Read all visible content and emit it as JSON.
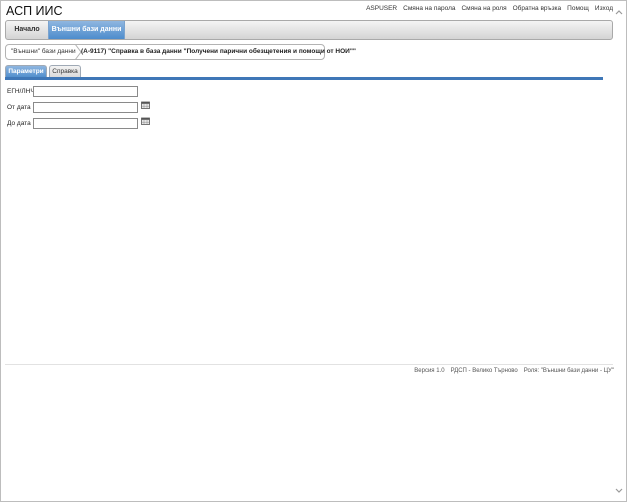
{
  "app": {
    "title": "АСП ИИС"
  },
  "toplinks": [
    "ASPUSER",
    "Смяна на парола",
    "Смяна на роля",
    "Обратна връзка",
    "Помощ",
    "Изход"
  ],
  "nav": {
    "home": "Начало",
    "active": "Външни бази данни"
  },
  "breadcrumb": {
    "first": "\"Външни\" бази данни",
    "current": "(А-9117) \"Справка в база данни \"Получени парични обезщетения и помощи от НОИ\"\""
  },
  "tabs": {
    "params": "Параметри",
    "report": "Справка"
  },
  "form": {
    "egn_label": "ЕГН/ЛНЧ",
    "egn_value": "",
    "from_label": "От дата",
    "from_value": "",
    "to_label": "До дата",
    "to_value": ""
  },
  "footer": {
    "version": "Версия 1.0",
    "office": "РДСП - Велико Търново",
    "role": "Роля: \"Външни бази данни - ЦУ\""
  },
  "colors": {
    "accent": "#4d8ccc",
    "tab_line": "#3f77b7"
  }
}
